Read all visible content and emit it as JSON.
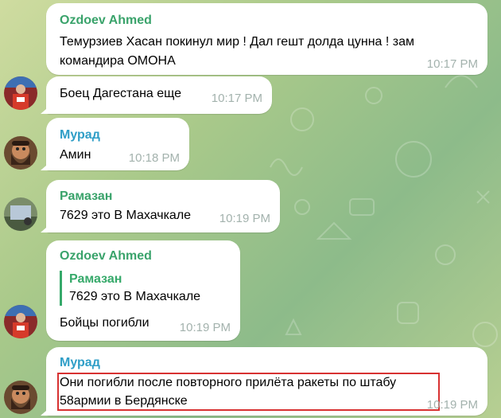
{
  "messages": [
    {
      "sender": "Ozdoev Ahmed",
      "text_line1": "Темурзиев Хасан покинул мир ! Дал гешт долда цунна ! зам",
      "text_line2": "командира ОМОНА",
      "time": "10:17 PM"
    },
    {
      "text": "Боец Дагестана еще",
      "time": "10:17 PM"
    },
    {
      "sender": "Мурад",
      "text": "Амин",
      "time": "10:18 PM"
    },
    {
      "sender": "Рамазан",
      "text": "7629 это В Махачкале",
      "time": "10:19 PM"
    },
    {
      "sender": "Ozdoev Ahmed",
      "reply_name": "Рамазан",
      "reply_text": "7629 это В Махачкале",
      "text": "Бойцы погибли",
      "time": "10:19 PM"
    },
    {
      "sender": "Мурад",
      "text_line1": "Они погибли после повторного прилёта ракеты по штабу",
      "text_line2": "58армии в Бердянске",
      "time": "10:19 PM"
    }
  ],
  "colors": {
    "ozdoev_name": "#3aa36b",
    "murad_name": "#2f9ec7",
    "ramazan_name": "#3aa36b",
    "highlight_border": "#d83232",
    "time": "#a3b2ad"
  }
}
